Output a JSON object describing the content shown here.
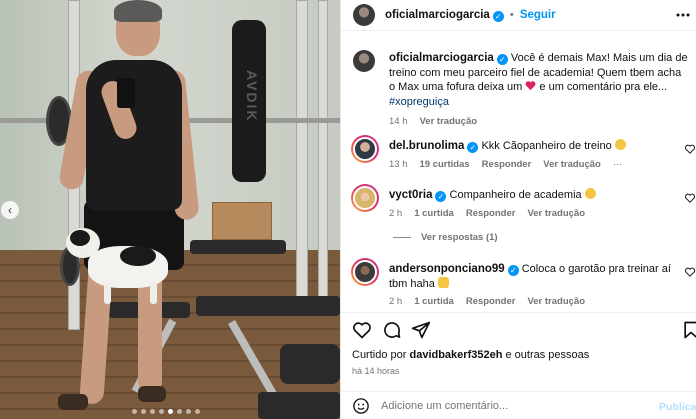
{
  "post": {
    "author": "oficialmarciogarcia",
    "follow_label": "Seguir",
    "caption_text": "Você é demais Max! Mais um dia de treino com meu parceiro fiel de academia! Quem tbem acha o Max uma fofura deixa um",
    "caption_tail": "e um comentário pra ele...",
    "hashtag": "#xopreguiça",
    "caption_age": "14 h",
    "see_translation": "Ver tradução"
  },
  "photo": {
    "bag_text": "AVDIK",
    "carousel_dots": 8,
    "active_dot": 4
  },
  "comments": [
    {
      "user": "del.brunolima",
      "text": "Kkk Cãopanheiro de treino",
      "age": "13 h",
      "likes": "19 curtidas",
      "reply": "Responder",
      "translate": "Ver tradução",
      "more": "···"
    },
    {
      "user": "vyct0ria",
      "text": "Companheiro de academia",
      "age": "2 h",
      "likes": "1 curtida",
      "reply": "Responder",
      "translate": "Ver tradução",
      "view_replies": "Ver respostas (1)"
    },
    {
      "user": "andersonponciano99",
      "text": "Coloca o garotão pra treinar aí tbm haha",
      "age": "2 h",
      "likes": "1 curtida",
      "reply": "Responder",
      "translate": "Ver tradução"
    }
  ],
  "footer": {
    "liked_prefix": "Curtido por",
    "liked_user": "davidbakerf352eh",
    "liked_suffix": "e outras pessoas",
    "post_time": "há 14 horas",
    "comment_placeholder": "Adicione um comentário...",
    "publish_label": "Publicar"
  },
  "colors": {
    "accent": "#0095f6",
    "heart": "#ed4956",
    "muted": "#737373"
  }
}
